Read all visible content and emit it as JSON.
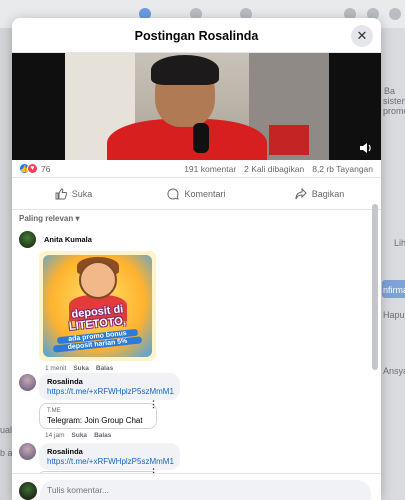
{
  "background": {
    "right_snippets": [
      "Ba",
      "sistem",
      "promo",
      "Lih",
      "nfirma",
      "Hapus",
      "Ansyah"
    ],
    "left_snippets": [
      "ual",
      "b ac"
    ]
  },
  "modal": {
    "title": "Postingan Rosalinda",
    "close_label": "✕"
  },
  "post_stats": {
    "reaction_count": "76",
    "comments": "191 komentar",
    "shares": "2 Kali dibagikan",
    "views": "8,2 rb Tayangan"
  },
  "actions": {
    "like": "Suka",
    "comment": "Komentari",
    "share": "Bagikan"
  },
  "filter": {
    "label": "Paling relevan",
    "chevron": "▾"
  },
  "comments": [
    {
      "author": "Anita Kumala",
      "sticker": {
        "line1": "deposit di",
        "line2": "LITETOTO,",
        "line3": "ada promo bonus",
        "line4": "deposit harian 5%"
      },
      "time": "1 menit",
      "like": "Suka",
      "reply": "Balas"
    },
    {
      "author": "Rosalinda",
      "link": "https://t.me/+xRFWHplzP5szMmM1",
      "card_domain": "T.ME",
      "card_title": "Telegram: Join Group Chat",
      "time": "14 jam",
      "like": "Suka",
      "reply": "Balas"
    },
    {
      "author": "Rosalinda",
      "link": "https://t.me/+xRFWHplzP5szMmM1"
    }
  ],
  "composer": {
    "placeholder": "Tulis komentar..."
  }
}
